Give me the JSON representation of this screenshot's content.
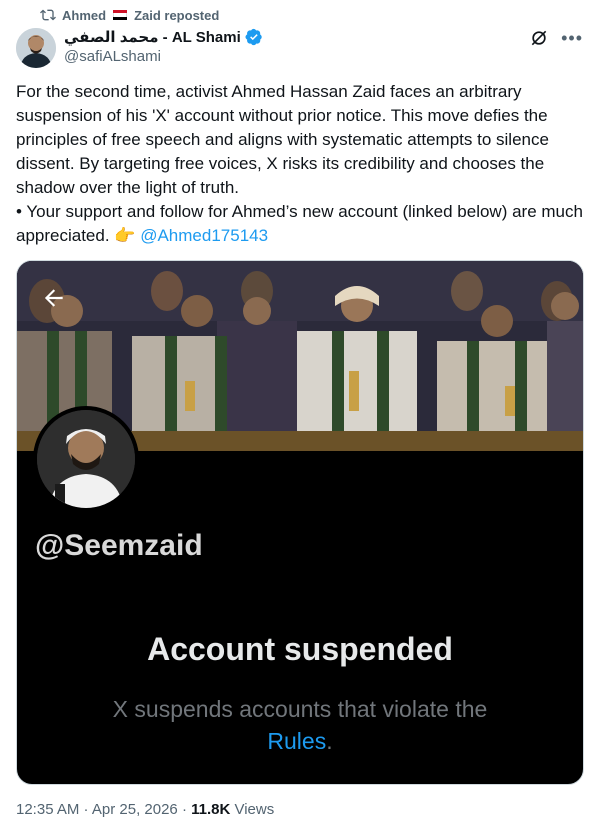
{
  "repost": {
    "name_before": "Ahmed",
    "name_after": "Zaid reposted",
    "flag_colors": [
      "#ce1126",
      "#ffffff",
      "#000000"
    ]
  },
  "author": {
    "display_name": "محمد الصفي - AL Shami",
    "handle": "@safiALshami",
    "verified_color": "#1d9bf0"
  },
  "tweet": {
    "paragraph1": "For the second time, activist Ahmed Hassan Zaid faces an arbitrary suspension of his 'X' account without prior notice. This move defies the principles of free speech and aligns with systematic attempts to silence dissent. By targeting free voices, X risks its credibility and chooses the shadow over the light of truth.",
    "paragraph2_text": "• Your support and follow for Ahmed’s new account (linked below) are much appreciated. ",
    "pointing_emoji": "👉",
    "mention": "@Ahmed175143"
  },
  "media": {
    "profile_handle": "@Seemzaid",
    "suspended_title": "Account suspended",
    "suspended_desc": "X suspends accounts that violate the",
    "rules_link": "Rules",
    "period": "."
  },
  "meta": {
    "time_date": "12:35 AM · Apr 25, 2026 · ",
    "views_count": "11.8K",
    "views_label": " Views"
  },
  "icons": [
    "repost-icon",
    "verified-icon",
    "grok-icon",
    "more-icon",
    "back-arrow-icon"
  ]
}
